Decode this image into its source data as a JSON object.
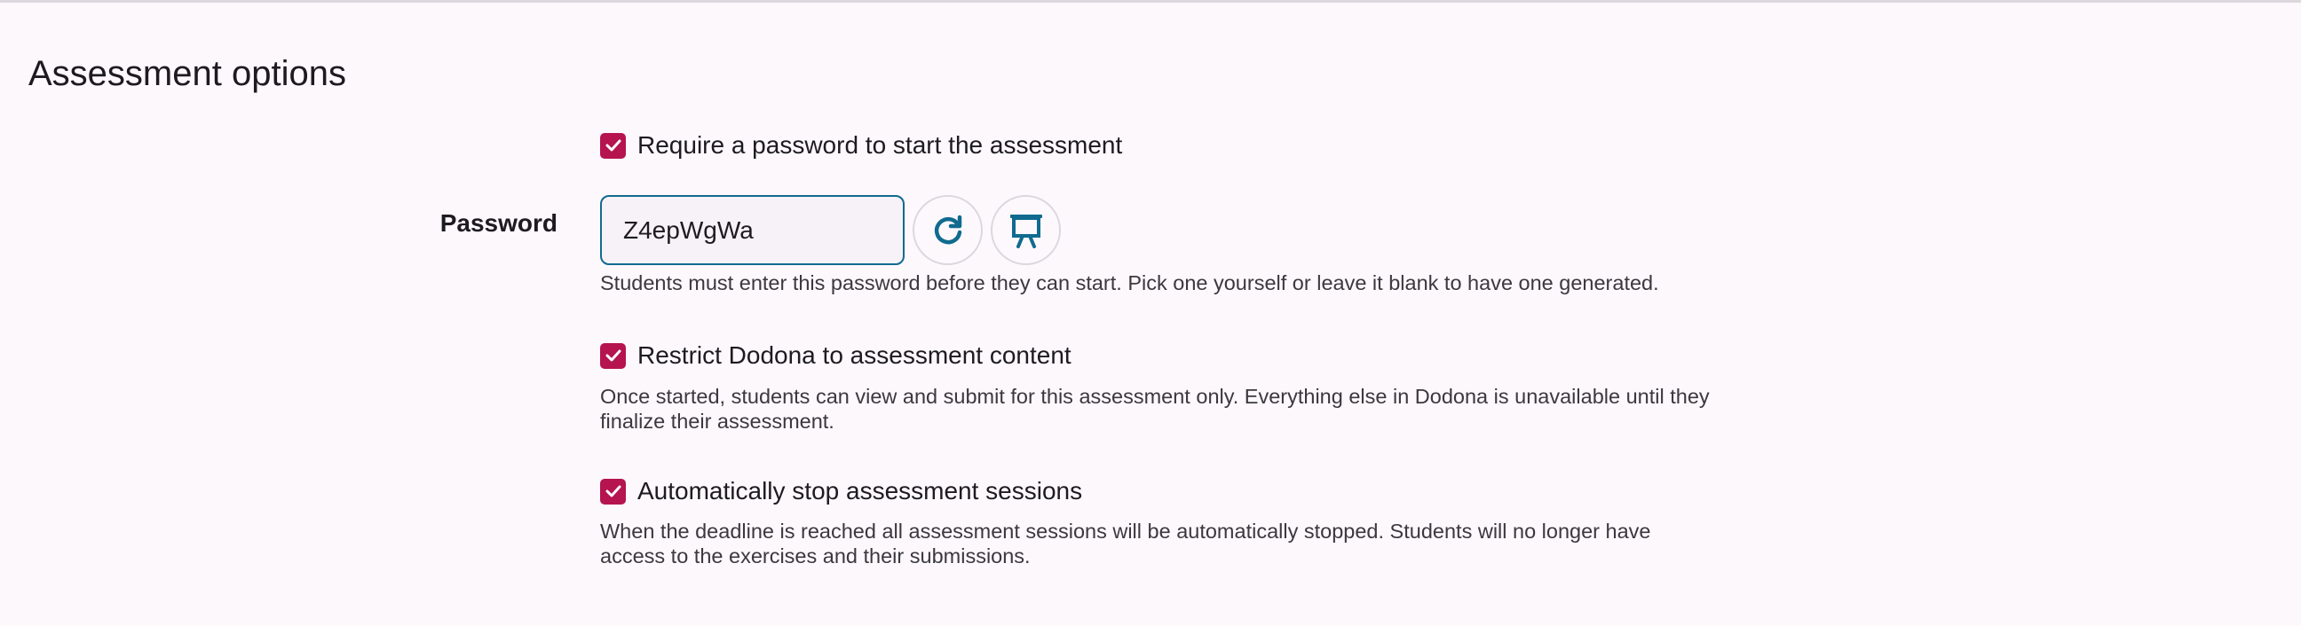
{
  "section": {
    "title": "Assessment options"
  },
  "password_option": {
    "checkbox_label": "Require a password to start the assessment",
    "checked": true
  },
  "password_field": {
    "label": "Password",
    "value": "Z4epWgWa",
    "help": "Students must enter this password before they can start. Pick one yourself or leave it blank to have one generated.",
    "regenerate_icon": "refresh-icon",
    "present_icon": "presentation-board-icon"
  },
  "restrict_option": {
    "checkbox_label": "Restrict Dodona to assessment content",
    "checked": true,
    "help": "Once started, students can view and submit for this assessment only. Everything else in Dodona is unavailable until they finalize their assessment."
  },
  "autostop_option": {
    "checkbox_label": "Automatically stop assessment sessions",
    "checked": true,
    "help": "When the deadline is reached all assessment sessions will be automatically stopped. Students will no longer have access to the exercises and their submissions."
  },
  "colors": {
    "checkbox": "#b5144f",
    "accent": "#106b8f",
    "background": "#fcf8fc"
  }
}
